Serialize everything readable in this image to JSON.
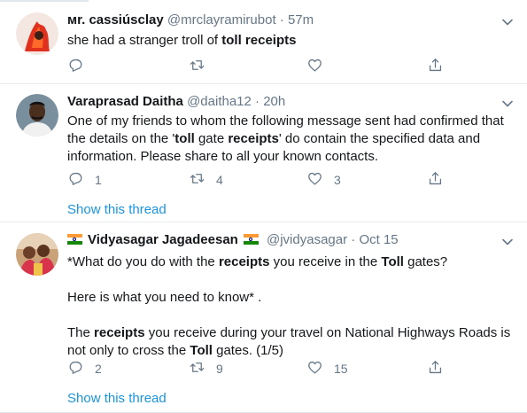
{
  "tweets": [
    {
      "name": "ᴍr. cassiúsclay",
      "handle": "@mrclayramirubot",
      "sep": "·",
      "time": "57m",
      "body_lines": [
        [
          {
            "t": "she had a stranger troll of ",
            "b": false
          },
          {
            "t": "toll receipts",
            "b": true
          }
        ]
      ],
      "actions": {
        "reply": "",
        "retweet": "",
        "like": ""
      },
      "show_thread": ""
    },
    {
      "name": "Varaprasad Daitha",
      "handle": "@daitha12",
      "sep": "·",
      "time": "20h",
      "body_lines": [
        [
          {
            "t": "One of my friends to whom the following message sent had confirmed that the details on the '",
            "b": false
          },
          {
            "t": "toll",
            "b": true
          },
          {
            "t": " gate ",
            "b": false
          },
          {
            "t": "receipts",
            "b": true
          },
          {
            "t": "' do contain the specified data and information. Please share to all your known contacts.",
            "b": false
          }
        ]
      ],
      "actions": {
        "reply": "1",
        "retweet": "4",
        "like": "3"
      },
      "show_thread": "Show this thread"
    },
    {
      "name": "Vidyasagar Jagadeesan",
      "handle": "@jvidyasagar",
      "sep": "·",
      "time": "Oct 15",
      "body_paragraphs": [
        [
          {
            "t": "*What do you do with the ",
            "b": false
          },
          {
            "t": "receipts",
            "b": true
          },
          {
            "t": " you receive in the ",
            "b": false
          },
          {
            "t": "Toll",
            "b": true
          },
          {
            "t": " gates?",
            "b": false
          }
        ],
        [
          {
            "t": "Here is what you need to know* .",
            "b": false
          }
        ],
        [
          {
            "t": "The ",
            "b": false
          },
          {
            "t": "receipts",
            "b": true
          },
          {
            "t": " you receive during your travel on National Highways Roads is not only to cross the ",
            "b": false
          },
          {
            "t": "Toll",
            "b": true
          },
          {
            "t": " gates. (1/5)",
            "b": false
          }
        ]
      ],
      "actions": {
        "reply": "2",
        "retweet": "9",
        "like": "15"
      },
      "show_thread": "Show this thread"
    }
  ],
  "icons": {
    "reply": "reply-icon",
    "retweet": "retweet-icon",
    "like": "like-icon",
    "share": "share-icon",
    "caret": "chevron-down-icon",
    "flag": "india-flag-icon"
  },
  "colors": {
    "text": "#14171a",
    "secondary": "#657786",
    "link": "#1b95e0",
    "divider": "#e6ecf0"
  }
}
